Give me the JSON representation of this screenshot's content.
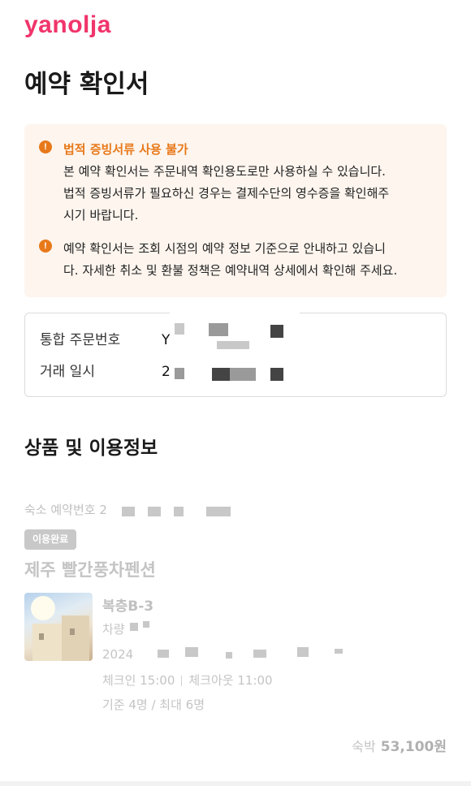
{
  "brand": {
    "logo_text": "yanolja",
    "color": "#f0356b"
  },
  "page": {
    "title": "예약 확인서"
  },
  "notice": {
    "accent_color": "#e8791a",
    "items": [
      {
        "icon": "exclamation-circle-icon",
        "title": "법적 증빙서류 사용 불가",
        "lines": [
          "본 예약 확인서는 주문내역 확인용도로만 사용하실 수 있습니다.",
          "법적 증빙서류가 필요하신 경우는 결제수단의 영수증을 확인해주",
          "시기 바랍니다."
        ]
      },
      {
        "icon": "exclamation-circle-icon",
        "lines": [
          "예약 확인서는 조회 시점의 예약 정보 기준으로 안내하고 있습니",
          "다. 자세한 취소 및 환불 정책은 예약내역 상세에서 확인해 주세요."
        ]
      }
    ]
  },
  "order": {
    "order_no_label": "통합 주문번호",
    "order_no_value": "Y",
    "date_label": "거래 일시",
    "date_value": "2"
  },
  "section": {
    "title": "상품 및 이용정보"
  },
  "product": {
    "stay_no_label": "숙소 예약번호 2",
    "status_badge": "이용완료",
    "hotel_name": "제주 빨간풍차펜션",
    "thumbnail_icon": "hotel-photo",
    "room_type": "복층B-3",
    "vehicle_label": "차량",
    "date_prefix": "2024",
    "check_in": "체크인 15:00",
    "check_out": "체크아웃 11:00",
    "capacity": "기준 4명 / 최대 6명",
    "price_label": "숙박",
    "price_value": "53,100원"
  }
}
